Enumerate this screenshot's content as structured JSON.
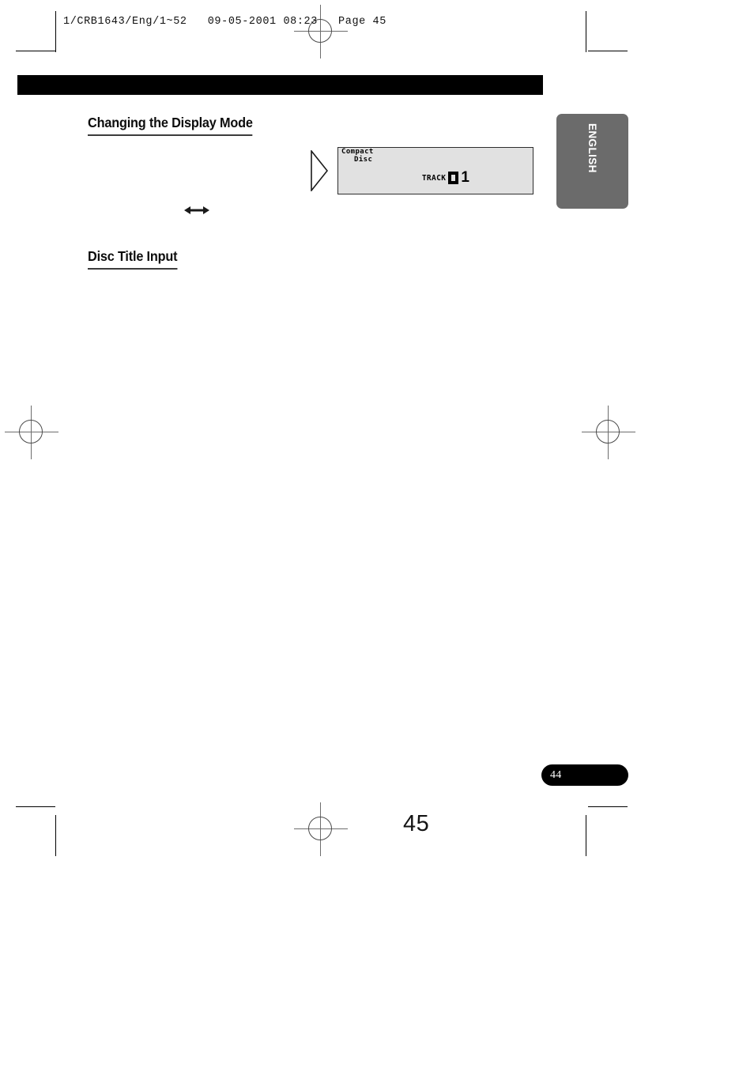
{
  "document": {
    "header_line": "1/CRB1643/Eng/1~52   09-05-2001 08:23   Page 45",
    "folio": "45",
    "page_reference_badge": "44",
    "language_tab": "ENGLISH"
  },
  "sections": [
    {
      "id": "display_mode",
      "heading": "Changing the Display Mode",
      "toggle_symbol": "↔"
    },
    {
      "id": "disc_title",
      "heading": "Disc Title Input"
    }
  ],
  "lcd_illustration": {
    "pointer": "triangle-pointer",
    "logo_line_1": "Compact",
    "logo_line_2": "Disc",
    "track_label": "TRACK",
    "track_tens_digit": "0",
    "track_ones_digit": "1"
  },
  "print_marks": {
    "registration_targets": 4,
    "crop_marks": 8
  },
  "colors": {
    "section_rule": "#000000",
    "lcd_background": "#e1e1e1",
    "lcd_border": "#2d2d2d",
    "language_tab": "#6b6b6b",
    "badge": "#000000",
    "heading_underline": "#3c3c3c"
  }
}
